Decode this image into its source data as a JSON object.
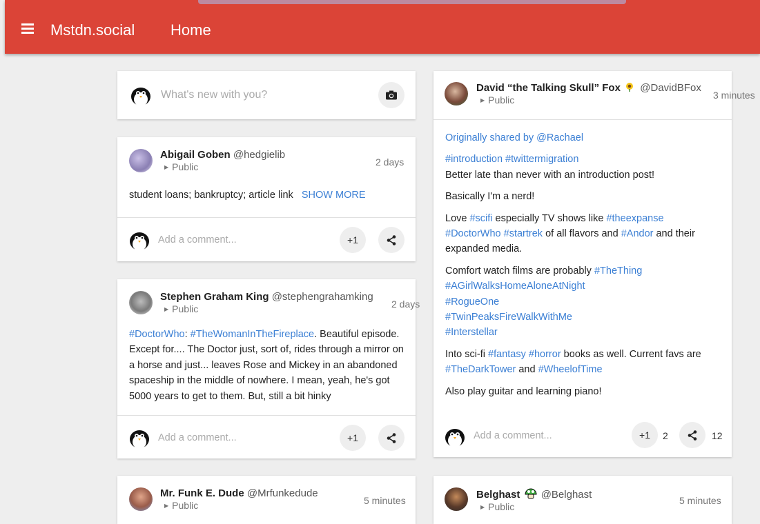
{
  "app": {
    "name": "Mstdn.social",
    "page": "Home"
  },
  "compose": {
    "placeholder": "What's new with you?"
  },
  "comment_placeholder": "Add a comment...",
  "posts": {
    "abigail": {
      "name": "Abigail Goben",
      "handle": "@hedgielib",
      "visibility": "Public",
      "time": "2 days",
      "text": "student loans; bankruptcy; article link",
      "show_more": "SHOW MORE",
      "plus": "+1"
    },
    "stephen": {
      "name": "Stephen Graham King",
      "handle": "@stephengrahamking",
      "visibility": "Public",
      "time": "2 days",
      "tag1": "#DoctorWho",
      "colon": ": ",
      "tag2": "#TheWomanInTheFireplace",
      "text": ". Beautiful episode. Except for.... The Doctor just, sort of, rides through a mirror on a horse and just... leaves Rose and Mickey in an abandoned spaceship in the middle of nowhere. I mean, yeah, he's got 5000 years to get to them. But, still a bit hinky",
      "plus": "+1"
    },
    "funk": {
      "name": "Mr. Funk E. Dude",
      "handle": "@Mrfunkedude",
      "visibility": "Public",
      "time": "5 minutes"
    },
    "david": {
      "name": "David “the Talking Skull” Fox",
      "handle": "@DavidBFox",
      "visibility": "Public",
      "time": "3 minutes",
      "shared": "Originally shared by @Rachael",
      "tags1": "#introduction #twittermigration",
      "line1": "Better late than never with an introduction post!",
      "line2": "Basically I'm a nerd!",
      "love_a": "Love ",
      "love_scifi": "#scifi",
      "love_b": " especially TV shows like ",
      "love_expanse": "#theexpanse",
      "love_dw": "#DoctorWho",
      "love_sp": " ",
      "love_st": "#startrek",
      "love_c": " of all flavors and ",
      "love_andor": "#Andor",
      "love_d": " and their expanded media.",
      "comfort_a": "Comfort watch films are probably ",
      "film1": "#TheThing",
      "film2": "#AGirlWalksHomeAloneAtNight",
      "film3": "#RogueOne",
      "film4": "#TwinPeaksFireWalkWithMe",
      "film5": "#Interstellar",
      "into_a": "Into sci-fi ",
      "into_fantasy": "#fantasy",
      "into_sp": " ",
      "into_horror": "#horror",
      "into_b": " books as well. Current favs are ",
      "into_dark": "#TheDarkTower",
      "into_and": " and ",
      "into_wot": "#WheelofTime",
      "line_last": "Also play guitar and learning piano!",
      "plus": "+1",
      "plus_count": "2",
      "share_count": "12"
    },
    "belghast": {
      "name": "Belghast",
      "handle": "@Belghast",
      "visibility": "Public",
      "time": "5 minutes"
    }
  }
}
